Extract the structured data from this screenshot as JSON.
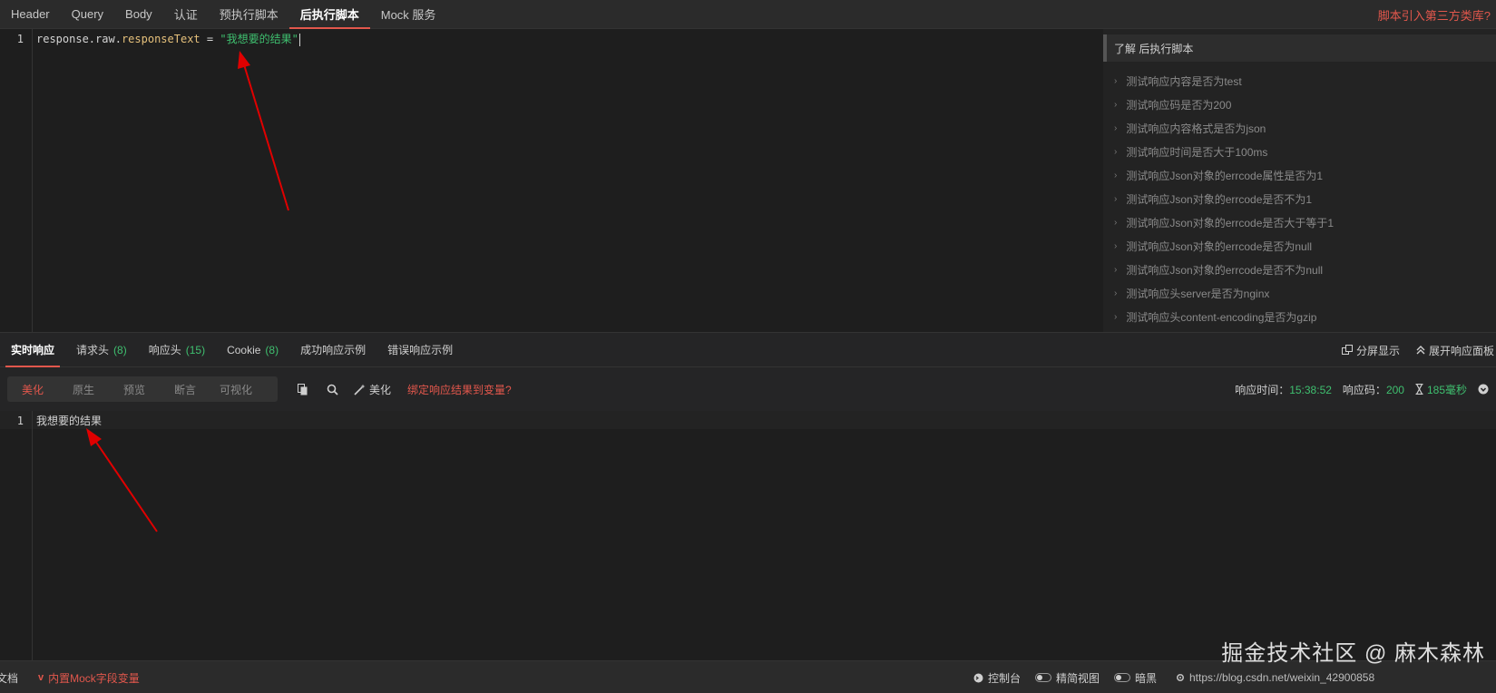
{
  "top_tabs": [
    "Header",
    "Query",
    "Body",
    "认证",
    "预执行脚本",
    "后执行脚本",
    "Mock 服务"
  ],
  "top_right_link": "脚本引入第三方类库?",
  "editor": {
    "line_number": "1",
    "code": {
      "obj": "response",
      "dot1": ".",
      "raw": "raw",
      "dot2": ".",
      "prop": "responseText",
      "op": " = ",
      "str": "\"我想要的结果\""
    }
  },
  "snippets": {
    "header": "了解 后执行脚本",
    "items": [
      "测试响应内容是否为test",
      "测试响应码是否为200",
      "测试响应内容格式是否为json",
      "测试响应时间是否大于100ms",
      "测试响应Json对象的errcode属性是否为1",
      "测试响应Json对象的errcode是否不为1",
      "测试响应Json对象的errcode是否大于等于1",
      "测试响应Json对象的errcode是否为null",
      "测试响应Json对象的errcode是否不为null",
      "测试响应头server是否为nginx",
      "测试响应头content-encoding是否为gzip"
    ]
  },
  "response_tabs": {
    "realtime": "实时响应",
    "req_headers": "请求头",
    "req_headers_count": "(8)",
    "resp_headers": "响应头",
    "resp_headers_count": "(15)",
    "cookie": "Cookie",
    "cookie_count": "(8)",
    "success_example": "成功响应示例",
    "error_example": "错误响应示例",
    "split_view": "分屏显示",
    "expand_panel": "展开响应面板"
  },
  "toolbar": {
    "modes": [
      "美化",
      "原生",
      "预览",
      "断言",
      "可视化"
    ],
    "beautify": "美化",
    "bind_var": "绑定响应结果到变量?",
    "time_label": "响应时间：",
    "time_value": "15:38:52",
    "code_label": "响应码：",
    "code_value": "200",
    "duration": "185毫秒"
  },
  "response_body": {
    "line_number": "1",
    "text": "我想要的结果"
  },
  "statusbar": {
    "doc": "文档",
    "mock_vars": "内置Mock字段变量",
    "console": "控制台",
    "compact": "精简视图",
    "dark": "暗黑",
    "url_partial": "https://blog.csdn.net/weixin_42900858"
  },
  "watermark": "掘金技术社区 @ 麻木森林",
  "colors": {
    "accent": "#e2574c",
    "green": "#3fbf6f",
    "editor_bg": "#1e1e1e",
    "panel_bg": "#252526"
  }
}
